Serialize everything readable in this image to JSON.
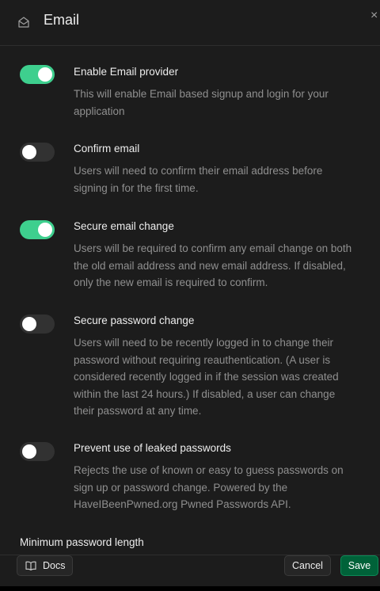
{
  "header": {
    "title": "Email",
    "icon": "mail-icon",
    "close_glyph": "×"
  },
  "settings": [
    {
      "label": "Enable Email provider",
      "description": "This will enable Email based signup and login for your application",
      "enabled": true
    },
    {
      "label": "Confirm email",
      "description": "Users will need to confirm their email address before signing in for the first time.",
      "enabled": false
    },
    {
      "label": "Secure email change",
      "description": "Users will be required to confirm any email change on both the old email address and new email address. If disabled, only the new email is required to confirm.",
      "enabled": true
    },
    {
      "label": "Secure password change",
      "description": "Users will need to be recently logged in to change their password without requiring reauthentication. (A user is considered recently logged in if the session was created within the last 24 hours.) If disabled, a user can change their password at any time.",
      "enabled": false
    },
    {
      "label": "Prevent use of leaked passwords",
      "description": "Rejects the use of known or easy to guess passwords on sign up or password change. Powered by the HaveIBeenPwned.org Pwned Passwords API.",
      "enabled": false
    }
  ],
  "min_password_label": "Minimum password length",
  "footer": {
    "docs_label": "Docs",
    "docs_icon": "book-icon",
    "cancel_label": "Cancel",
    "save_label": "Save"
  },
  "colors": {
    "toggle_on": "#3ecf8e",
    "save_button": "#006239"
  }
}
